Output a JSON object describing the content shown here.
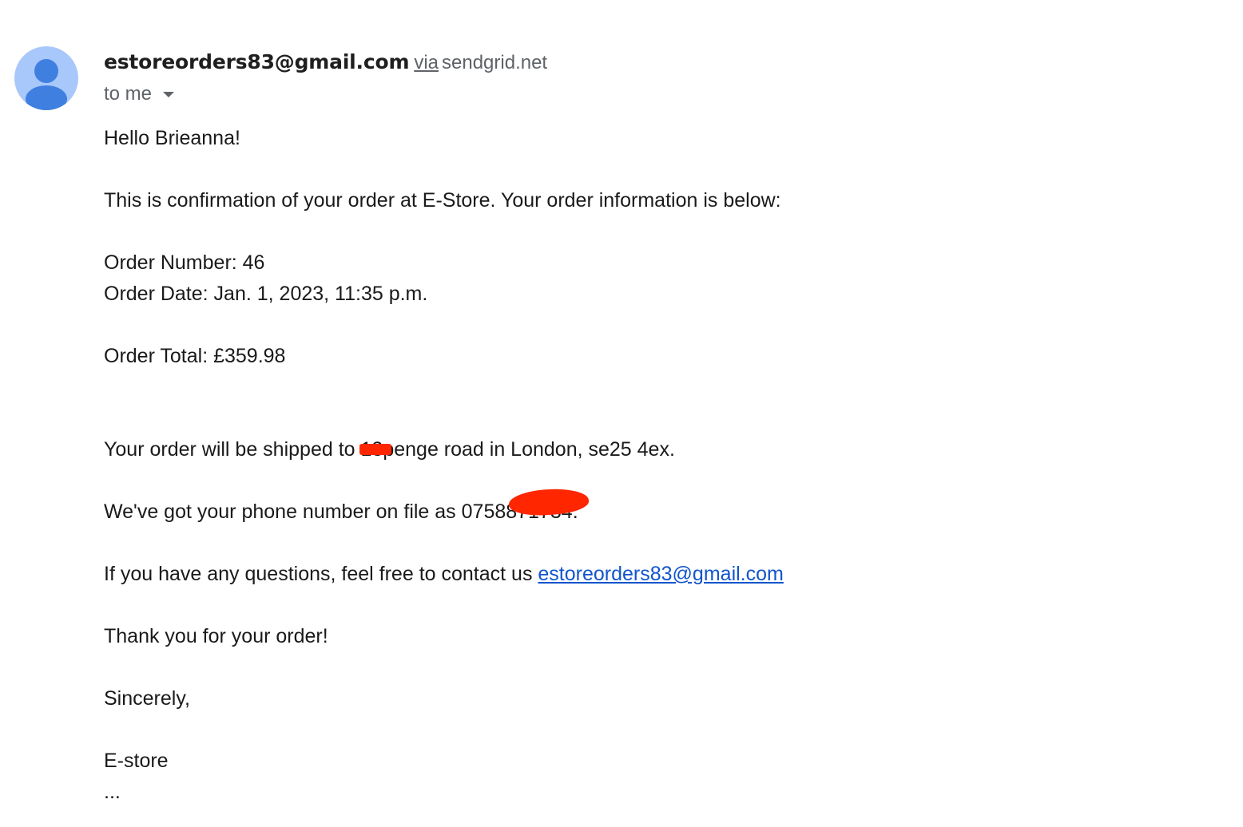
{
  "sender": {
    "email": "estoreorders83@gmail.com",
    "via_label": "via",
    "via_domain": "sendgrid.net",
    "recipient_label": "to me"
  },
  "colors": {
    "avatar_bg": "#a8c7fa",
    "avatar_fg": "#3f7fe0",
    "link": "#1155cc",
    "redaction": "#ff2600"
  },
  "icons": {
    "avatar": "person-icon",
    "recipient_dropdown": "triangle-down-icon"
  },
  "message": {
    "greeting": "Hello Brieanna!",
    "intro": "This is confirmation of your order at  E-Store. Your order information is below:",
    "order_number": "Order Number: 46",
    "order_date": "Order Date: Jan. 1, 2023, 11:35 p.m.",
    "order_total": "Order Total: £359.98",
    "shipping_prefix": "Your order will be shipped to",
    "shipping_redacted": "13",
    "shipping_suffix": "penge road in London, se25 4ex.",
    "phone_prefix": "We've got your phone number on file as 07588",
    "phone_redacted": "71734",
    "phone_suffix": ".",
    "contact_prefix": "If you have any questions, feel free to contact us",
    "contact_email": "estoreorders83@gmail.com",
    "thanks": "Thank you for your order!",
    "closing": "Sincerely,",
    "signature": "E-store",
    "trimmed": "..."
  }
}
